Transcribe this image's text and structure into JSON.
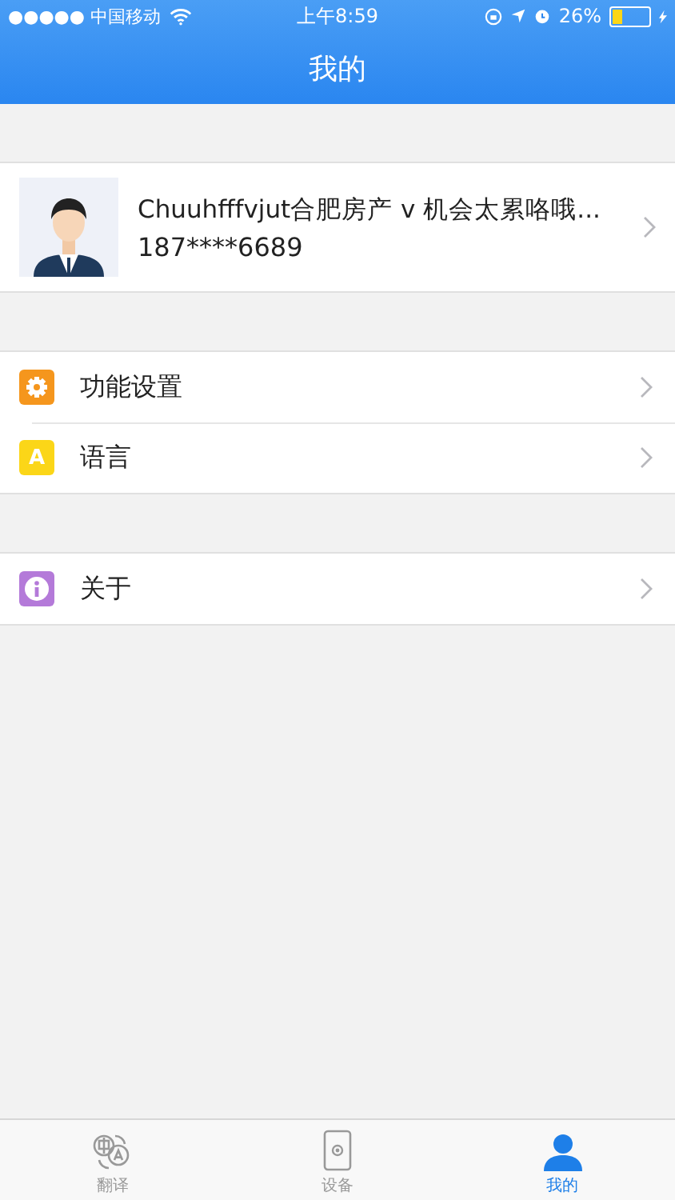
{
  "status_bar": {
    "carrier": "●●●●● 中国移动",
    "time": "上午8:59",
    "battery_percent": "26%"
  },
  "nav_bar": {
    "title": "我的"
  },
  "profile": {
    "name": "Chuuhfffvjut合肥房产 v 机会太累咯哦...",
    "phone": "187****6689"
  },
  "menu_groups": [
    {
      "items": [
        {
          "label": "功能设置",
          "kind": "gear",
          "color": "#f5961d"
        },
        {
          "label": "语言",
          "kind": "letter",
          "icon_text": "A",
          "color": "#fbd618"
        }
      ]
    },
    {
      "items": [
        {
          "label": "关于",
          "kind": "info",
          "color": "#b47ad9"
        }
      ]
    }
  ],
  "tab_bar": [
    {
      "label": "翻译",
      "kind": "translate",
      "selected": false
    },
    {
      "label": "设备",
      "kind": "device",
      "selected": false
    },
    {
      "label": "我的",
      "kind": "person",
      "selected": true
    }
  ]
}
